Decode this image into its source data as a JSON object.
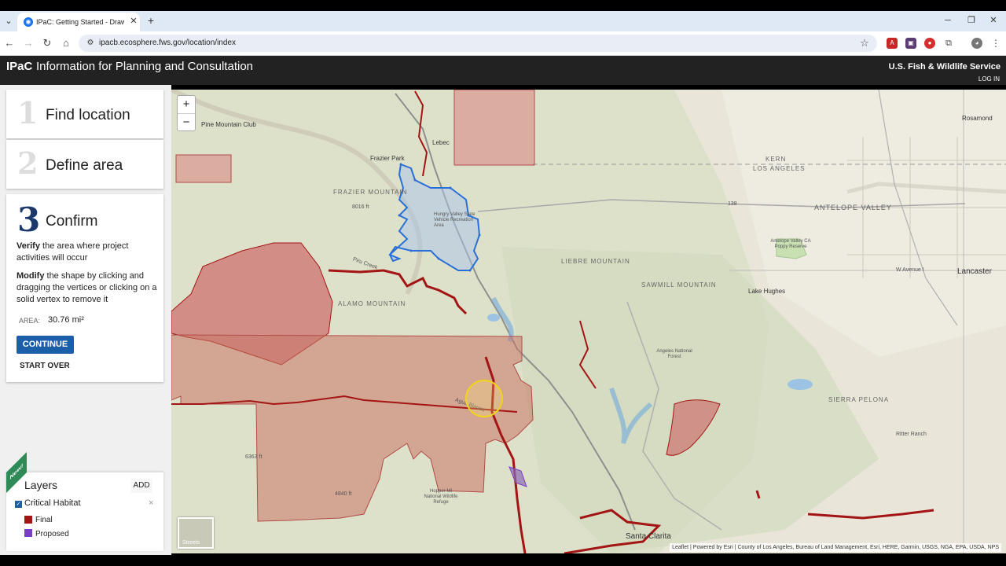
{
  "browser": {
    "tab_title": "IPaC: Getting Started - Draw on",
    "url": "ipacb.ecosphere.fws.gov/location/index"
  },
  "app": {
    "brand": "IPaC",
    "title": "Information for Planning and Consultation",
    "agency": "U.S. Fish & Wildlife Service",
    "login": "LOG IN"
  },
  "steps": [
    {
      "number": "1",
      "label": "Find location"
    },
    {
      "number": "2",
      "label": "Define area"
    },
    {
      "number": "3",
      "label": "Confirm"
    }
  ],
  "confirm": {
    "verify_bold": "Verify",
    "verify_text": " the area where project activities will occur",
    "modify_bold": "Modify",
    "modify_text": " the shape by clicking and dragging the vertices or clicking on a solid vertex to remove it",
    "area_label": "AREA:",
    "area_value": "30.76 mi²",
    "continue_label": "CONTINUE",
    "start_over_label": "START OVER"
  },
  "layers": {
    "badge": "New!",
    "title": "Layers",
    "add_label": "ADD",
    "critical_habitat": "Critical Habitat",
    "legend": [
      {
        "label": "Final",
        "color": "#a31515"
      },
      {
        "label": "Proposed",
        "color": "#7b3fc4"
      }
    ]
  },
  "map": {
    "zoom_in": "+",
    "zoom_out": "−",
    "basemap_label": "Streets",
    "attribution": "Leaflet | Powered by Esri | County of Los Angeles, Bureau of Land Management, Esri, HERE, Garmin, USGS, NGA, EPA, USDA, NPS",
    "labels": {
      "pine_mountain_club": "Pine Mountain Club",
      "lebec": "Lebec",
      "frazier_park": "Frazier Park",
      "frazier_mountain": "FRAZIER MOUNTAIN",
      "kern": "KERN",
      "los_angeles": "LOS ANGELES",
      "antelope_valley": "ANTELOPE VALLEY",
      "rosamond": "Rosamond",
      "hungry_valley": "Hungry Valley State Vehicle Recreation Area",
      "liebre_mountain": "LIEBRE MOUNTAIN",
      "sawmill_mountain": "SAWMILL MOUNTAIN",
      "poppy_reserve": "Antelope Valley CA Poppy Reserve",
      "lancaster": "Lancaster",
      "w_avenue": "W Avenue I",
      "lake_hughes": "Lake Hughes",
      "alamo_mountain": "ALAMO MOUNTAIN",
      "angeles_nf": "Angeles National Forest",
      "sierra_pelona": "SIERRA PELONA",
      "santa_clarita": "Santa Clarita",
      "hopper_mtn": "Hopper Mt National Wildlife Refuge",
      "ritter_ranch": "Ritter Ranch",
      "elev_8016": "8016 ft",
      "elev_6363": "6363 ft",
      "elev_4840": "4840 ft",
      "route_138": "138",
      "agua_blanca": "Agua Blanca",
      "piru_creek": "Piru Creek"
    }
  }
}
